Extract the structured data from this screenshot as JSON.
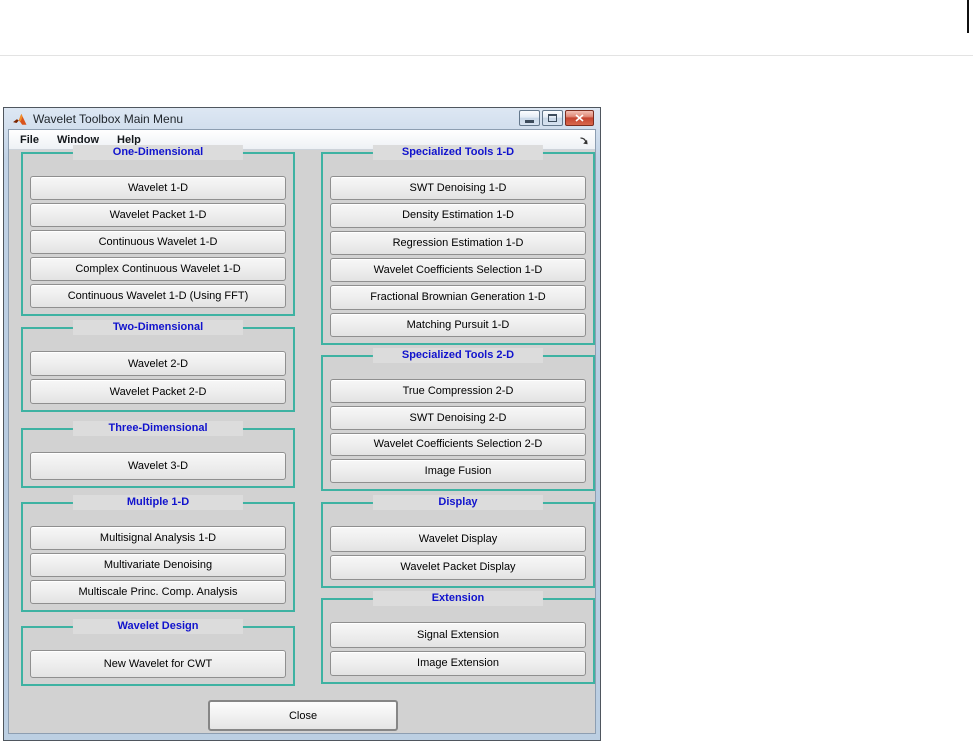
{
  "theme": {
    "teal": "#3eb2a2",
    "title-blue": "#1113cd",
    "client-gray": "#d2d2d2",
    "label-gray": "#dcdcdc",
    "close-red": "#c54430"
  },
  "window": {
    "title": "Wavelet Toolbox Main Menu",
    "menu_items": [
      {
        "label": "File"
      },
      {
        "label": "Window"
      },
      {
        "label": "Help"
      }
    ],
    "icons": {
      "app": "matlab-logo",
      "minimize": "minimize-dash",
      "maximize": "maximize-square",
      "close": "close-x",
      "dock": "dock-curl-arrow"
    }
  },
  "groups": {
    "left": [
      {
        "title": "One-Dimensional",
        "buttons": [
          "Wavelet 1-D",
          "Wavelet Packet 1-D",
          "Continuous Wavelet 1-D",
          "Complex Continuous Wavelet 1-D",
          "Continuous Wavelet 1-D (Using FFT)"
        ]
      },
      {
        "title": "Two-Dimensional",
        "buttons": [
          "Wavelet 2-D",
          "Wavelet Packet 2-D"
        ]
      },
      {
        "title": "Three-Dimensional",
        "buttons": [
          "Wavelet 3-D"
        ]
      },
      {
        "title": "Multiple 1-D",
        "buttons": [
          "Multisignal Analysis 1-D",
          "Multivariate Denoising",
          "Multiscale Princ. Comp. Analysis"
        ]
      },
      {
        "title": "Wavelet Design",
        "buttons": [
          "New Wavelet for CWT"
        ]
      }
    ],
    "right": [
      {
        "title": "Specialized Tools 1-D",
        "buttons": [
          "SWT Denoising 1-D",
          "Density Estimation 1-D",
          "Regression Estimation 1-D",
          "Wavelet Coefficients Selection 1-D",
          "Fractional Brownian Generation 1-D",
          "Matching Pursuit 1-D"
        ]
      },
      {
        "title": "Specialized Tools 2-D",
        "buttons": [
          "True Compression 2-D",
          "SWT Denoising 2-D",
          "Wavelet Coefficients Selection 2-D",
          "Image Fusion"
        ]
      },
      {
        "title": "Display",
        "buttons": [
          "Wavelet Display",
          "Wavelet Packet Display"
        ]
      },
      {
        "title": "Extension",
        "buttons": [
          "Signal Extension",
          "Image Extension"
        ]
      }
    ]
  },
  "footer": {
    "close_label": "Close"
  }
}
